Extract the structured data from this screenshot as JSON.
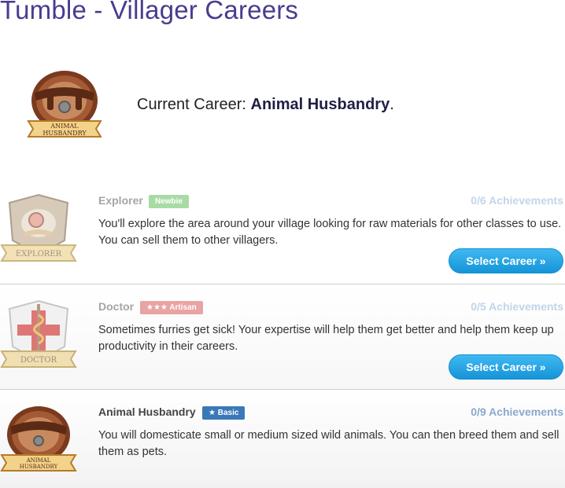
{
  "page": {
    "title": "Tumble - Villager Careers"
  },
  "current_career": {
    "prefix": "Current Career: ",
    "name": "Animal Husbandry",
    "suffix": "."
  },
  "careers": [
    {
      "name": "Explorer",
      "rank": "Newbie",
      "achievements": "0/6 Achievements",
      "description": "You'll explore the area around your village looking for raw materials for other classes to use. You can sell them to other villagers.",
      "button": "Select Career »",
      "badge_label": "EXPLORER"
    },
    {
      "name": "Doctor",
      "rank": "★★★ Artisan",
      "achievements": "0/5 Achievements",
      "description": "Sometimes furries get sick! Your expertise will help them get better and help them keep up productivity in their careers.",
      "button": "Select Career »",
      "badge_label": "DOCTOR"
    },
    {
      "name": "Animal Husbandry",
      "rank": "★ Basic",
      "achievements": "0/9 Achievements",
      "description": "You will domesticate small or medium sized wild animals. You can then breed them and sell them as pets.",
      "badge_label": "ANIMAL HUSBANDRY"
    }
  ],
  "colors": {
    "title": "#4a3b8f",
    "button": "#1694d8",
    "rank_newbie": "#a8dba3",
    "rank_artisan": "#e9a3a3",
    "rank_basic": "#3a78b8"
  },
  "icons": [
    "animal-husbandry-badge-icon",
    "explorer-badge-icon",
    "doctor-badge-icon"
  ]
}
